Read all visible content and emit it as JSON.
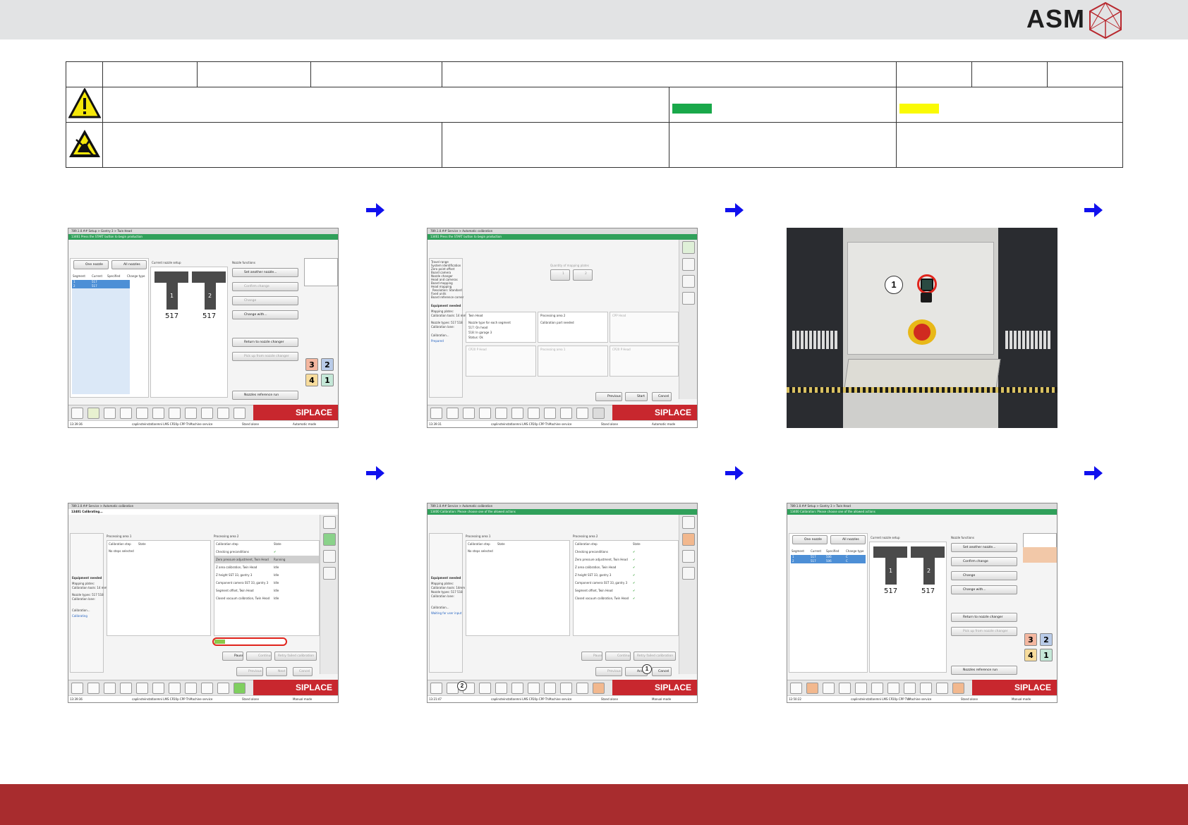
{
  "header": {
    "logo_text": "ASM",
    "colors": {
      "brand_red": "#a82c2e",
      "band_gray": "#e2e3e4",
      "arrow_blue": "#1010ee",
      "siplace_red": "#c8272e"
    }
  },
  "legend_table": {
    "icons": [
      "warning-triangle-icon",
      "esd-sensitive-icon"
    ],
    "status_colors": {
      "green": "#19a84a",
      "yellow": "#fafa05"
    }
  },
  "steps": [
    {
      "title": "789.1.0.## Setup > Gantry 3 > Twin Head",
      "message": "13461 Press the START button to begin production",
      "tabs": {
        "one": "One nozzle",
        "all": "All nozzles"
      },
      "columns": [
        "Segment",
        "Current",
        "Specified",
        "Change type"
      ],
      "rows": [
        [
          "1",
          "517",
          "",
          ""
        ],
        [
          "2",
          "517",
          "",
          ""
        ]
      ],
      "setup_label": "Current nozzle setup",
      "functions_label": "Nozzle functions",
      "segment_labels": [
        "1",
        "2"
      ],
      "nozzle_values": [
        "517",
        "517"
      ],
      "buttons": [
        "Set another nozzle...",
        "Confirm change",
        "Change",
        "Change with...",
        "Return to nozzle changer",
        "Pick up from nozzle changer",
        "Nozzles reference run"
      ],
      "tiles": [
        "3",
        "2",
        "4",
        "1"
      ],
      "status": {
        "time": "13:39:36",
        "host": "caplinsteinstatlanmni LMS CP20p CPP Th",
        "mode1": "Machine service",
        "mode2": "Stand alone",
        "mode3": "Automatic mode"
      }
    },
    {
      "title": "789.1.0.## Service > Automatic calibration",
      "message": "13461 Press the START button to begin production",
      "sidebar": [
        "Travel range",
        "System identification",
        "Zero point offset",
        "Board camera",
        "Nozzle changer",
        "Head and cameras",
        "Board mapping",
        "Head mapping",
        "Resolution: Standard",
        "Fixed units",
        "Board reference corner"
      ],
      "equipment_label": "Equipment needed",
      "equipment": [
        "Mapping plates:",
        "Calibration tools: 14 mm",
        "Nozzle types: 517 518",
        "Calibration lane:"
      ],
      "calib_label": "Calibration...",
      "calib_state": "Prepared",
      "mapping_label": "Quantity of mapping plates",
      "mapping_opts": [
        "1",
        "2"
      ],
      "cards": [
        {
          "title": "Twin Head",
          "lines": [
            "Nozzle type for each segment",
            "517: On head",
            "518: In garage 3",
            "Status: Ok"
          ]
        },
        {
          "title": "Processing area 2",
          "lines": [
            "Calibration part needed"
          ]
        },
        {
          "title": "CPP Head",
          "lines": []
        },
        {
          "title": "CP20 P Head",
          "lines": []
        },
        {
          "title": "Processing area 1",
          "lines": []
        },
        {
          "title": "CP20 P Head",
          "lines": []
        }
      ],
      "nav": {
        "prev": "Previous",
        "start": "Start",
        "cancel": "Cancel"
      },
      "status": {
        "time": "13:39:31",
        "host": "caplinsteinstatlanmni LMS CP20p CPP Th",
        "mode1": "Machine service",
        "mode2": "Stand alone",
        "mode3": "Automatic mode"
      }
    },
    {
      "callout": "1"
    },
    {
      "title": "789.1.0.## Service > Automatic calibration",
      "message": "13401 Calibrating...",
      "area1": "Processing area 1",
      "area2": "Processing area 2",
      "col_step": "Calibration step",
      "col_state": "State",
      "no_steps": "No steps selected",
      "steps_list": [
        [
          "Checking preconditions",
          "✔"
        ],
        [
          "Zero pressure adjustment, Twin Head",
          "Running"
        ],
        [
          "Z area calibration, Twin Head",
          "Idle"
        ],
        [
          "Z height SST 33, gantry 3",
          "Idle"
        ],
        [
          "Component camera SST 33, gantry 3",
          "Idle"
        ],
        [
          "Segment offset, Twin Head",
          "Idle"
        ],
        [
          "Closed vacuum calibration, Twin Head",
          "Idle"
        ]
      ],
      "equipment": [
        "Mapping plates:",
        "Calibration tools: 14 mm",
        "Nozzle types: 517 518",
        "Calibration lane:"
      ],
      "calib_label": "Calibration...",
      "calib_state": "Calibrating",
      "progress": 0.15,
      "buttons": {
        "pause": "Pause",
        "continue": "Continue",
        "retry": "Retry failed calibration",
        "prev": "Previous",
        "next": "Next",
        "cancel": "Cancel"
      },
      "status": {
        "time": "13:39:36",
        "host": "caplinsteinstatlanmni LMS CP20p CPP Th",
        "mode1": "Machine service",
        "mode2": "Stand alone",
        "mode3": "Manual mode"
      }
    },
    {
      "title": "789.1.0.## Service > Automatic calibration",
      "message": "13400 Calibration: Please choose one of the allowed actions",
      "area1": "Processing area 1",
      "area2": "Processing area 2",
      "col_step": "Calibration step",
      "col_state": "State",
      "no_steps": "No steps selected",
      "steps_list": [
        [
          "Checking preconditions",
          "✔"
        ],
        [
          "Zero pressure adjustment, Twin Head",
          "✔"
        ],
        [
          "Z area calibration, Twin Head",
          "✔"
        ],
        [
          "Z height SST 33, gantry 3",
          "✔"
        ],
        [
          "Component camera SST 33, gantry 3",
          "✔"
        ],
        [
          "Segment offset, Twin Head",
          "✔"
        ],
        [
          "Closed vacuum calibration, Twin Head",
          "✔"
        ]
      ],
      "equipment": [
        "Mapping plates:",
        "Calibration tools: 14mm",
        "Nozzle types: 517 518",
        "Calibration lane:"
      ],
      "calib_label": "Calibration...",
      "calib_state": "Waiting for user input",
      "buttons": {
        "pause": "Pause",
        "continue": "Continue",
        "retry": "Retry failed calibration",
        "prev": "Previous",
        "accept": "Accept",
        "cancel": "Cancel"
      },
      "callouts": [
        "1",
        "2"
      ],
      "status": {
        "time": "13:21:47",
        "host": "caplinsteinstatlanmni LMS CP20p CPP Th",
        "mode1": "Machine service",
        "mode2": "Stand alone",
        "mode3": "Manual mode"
      }
    },
    {
      "title": "789.1.0.## Setup > Gantry 3 > Twin Head",
      "message": "13400 Calibration: Please choose one of the allowed actions",
      "tabs": {
        "one": "One nozzle",
        "all": "All nozzles"
      },
      "columns": [
        "Segment",
        "Current",
        "Specified",
        "Change type"
      ],
      "rows": [
        [
          "1",
          "517",
          "506",
          "C"
        ],
        [
          "2",
          "517",
          "506",
          "C"
        ]
      ],
      "setup_label": "Current nozzle setup",
      "functions_label": "Nozzle functions",
      "segment_labels": [
        "1",
        "2"
      ],
      "nozzle_values": [
        "517",
        "517"
      ],
      "buttons": [
        "Set another nozzle...",
        "Confirm change",
        "Change",
        "Change with...",
        "Return to nozzle changer",
        "Pick up from nozzle changer",
        "Nozzles reference run"
      ],
      "tiles": [
        "3",
        "2",
        "4",
        "1"
      ],
      "status": {
        "time": "12:50:22",
        "host": "caplinsteinstatlanmni LMS CP20p CPP TW",
        "mode1": "Machine service",
        "mode2": "Stand alone",
        "mode3": "Manual mode"
      }
    }
  ],
  "siplace_label": "SIPLACE"
}
